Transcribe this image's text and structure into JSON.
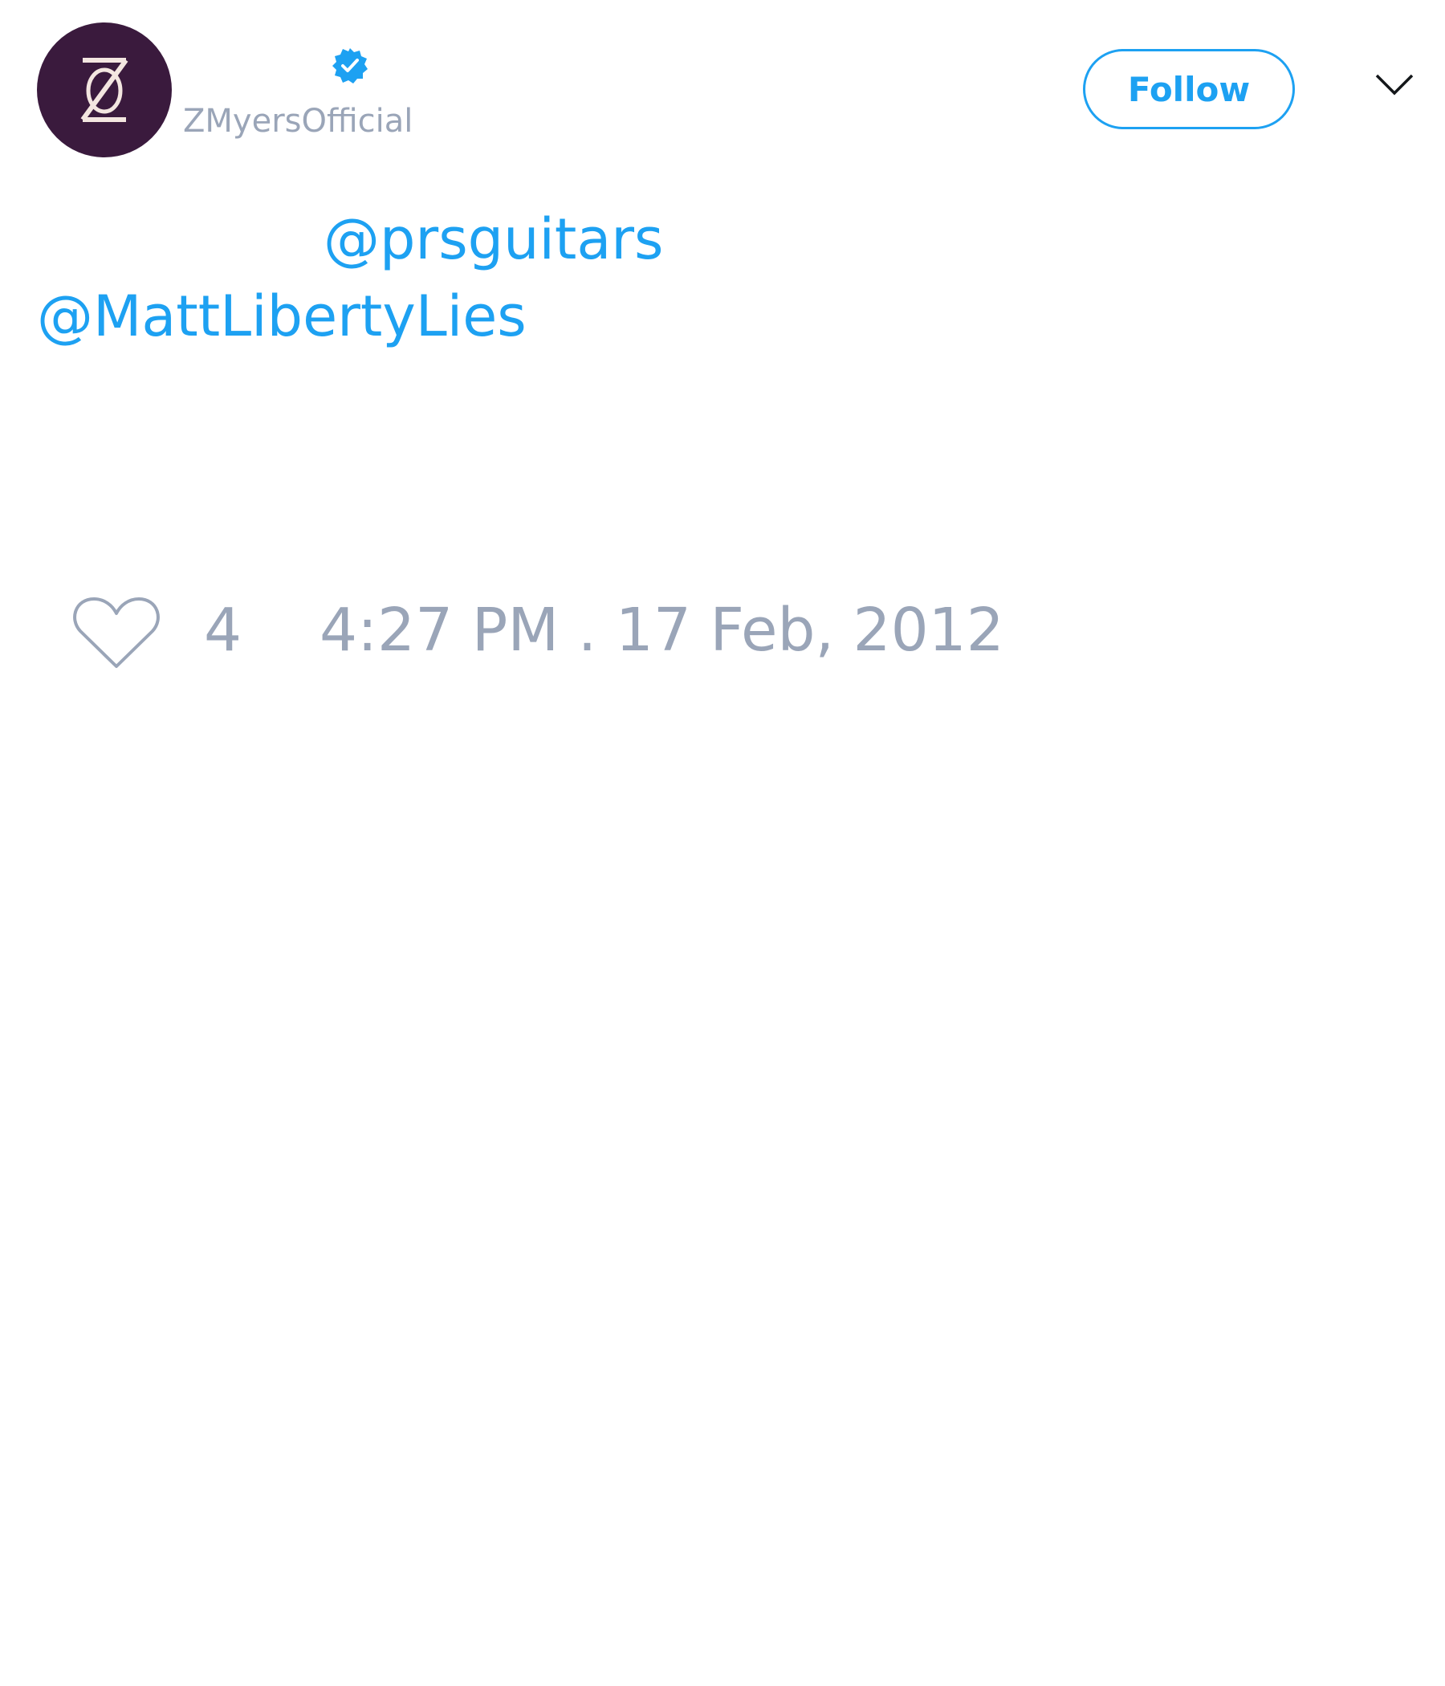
{
  "account": {
    "handle": "ZMyersOfficial",
    "verified": true,
    "avatar_bg": "#3a1a3d",
    "avatar_icon": "zm-logo-icon"
  },
  "header": {
    "follow_label": "Follow",
    "menu_icon": "chevron-down-icon"
  },
  "tweet": {
    "mentions": [
      "@prsguitars",
      "@MattLibertyLies"
    ]
  },
  "footer": {
    "like_icon": "heart-icon",
    "like_count": "4",
    "timestamp": "4:27 PM . 17 Feb, 2012"
  },
  "colors": {
    "accent": "#1da1f2",
    "muted": "#9aa5b8"
  }
}
